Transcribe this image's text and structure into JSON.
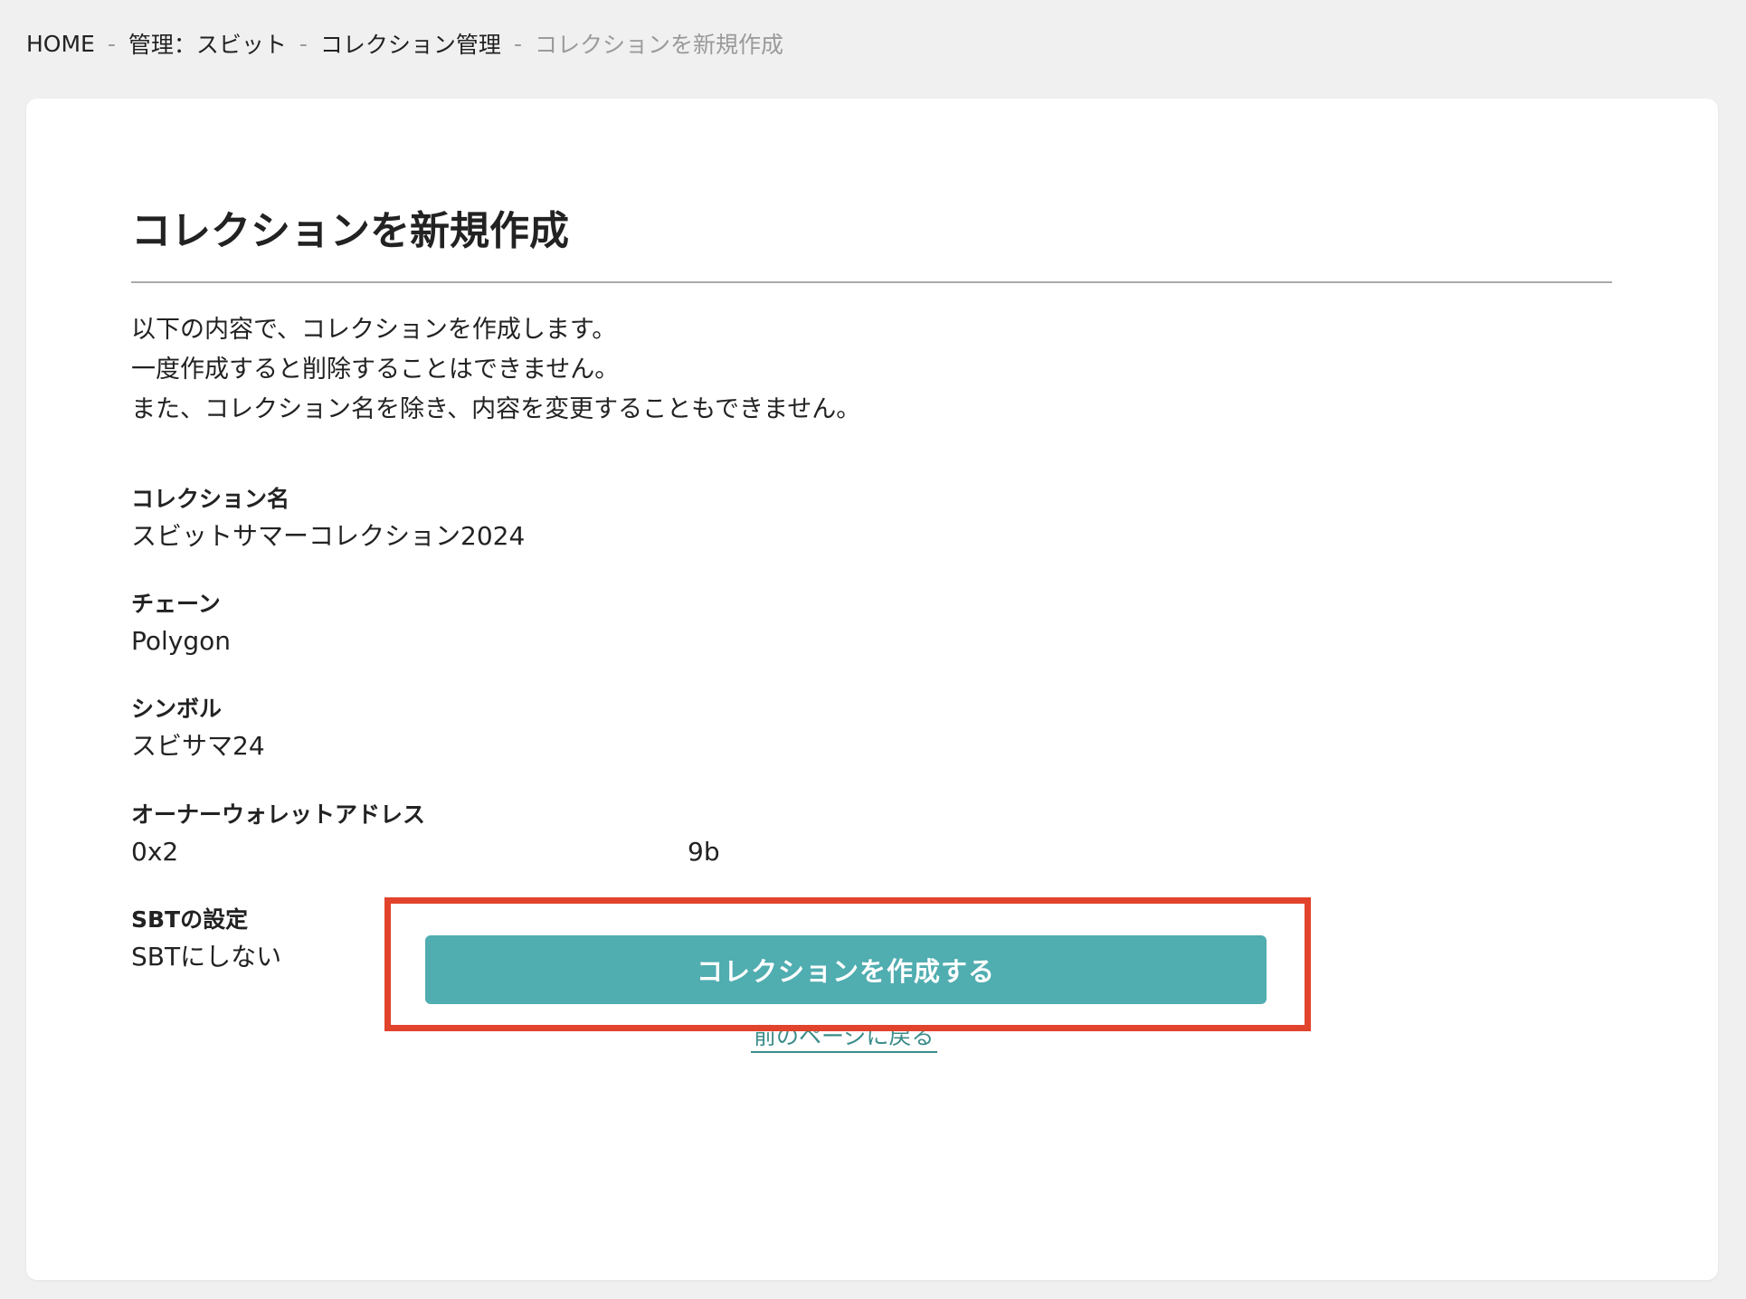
{
  "breadcrumb": {
    "items": [
      "HOME",
      "管理：スビット",
      "コレクション管理"
    ],
    "current": "コレクションを新規作成",
    "separator": "-"
  },
  "page": {
    "title": "コレクションを新規作成",
    "intro_lines": [
      "以下の内容で、コレクションを作成します。",
      "一度作成すると削除することはできません。",
      "また、コレクション名を除き、内容を変更することもできません。"
    ]
  },
  "fields": {
    "collection_name": {
      "label": "コレクション名",
      "value": "スビットサマーコレクション2024"
    },
    "chain": {
      "label": "チェーン",
      "value": "Polygon"
    },
    "symbol": {
      "label": "シンボル",
      "value": "スビサマ24"
    },
    "owner_wallet": {
      "label": "オーナーウォレットアドレス",
      "value_start": "0x2",
      "value_end": "9b"
    },
    "sbt": {
      "label": "SBTの設定",
      "value": "SBTにしない"
    }
  },
  "actions": {
    "create_label": "コレクションを作成する",
    "back_label": "前のページに戻る"
  },
  "colors": {
    "button": "#50adb0",
    "highlight": "#e2432c",
    "link": "#3a8c8a",
    "background": "#f0f0f0"
  }
}
